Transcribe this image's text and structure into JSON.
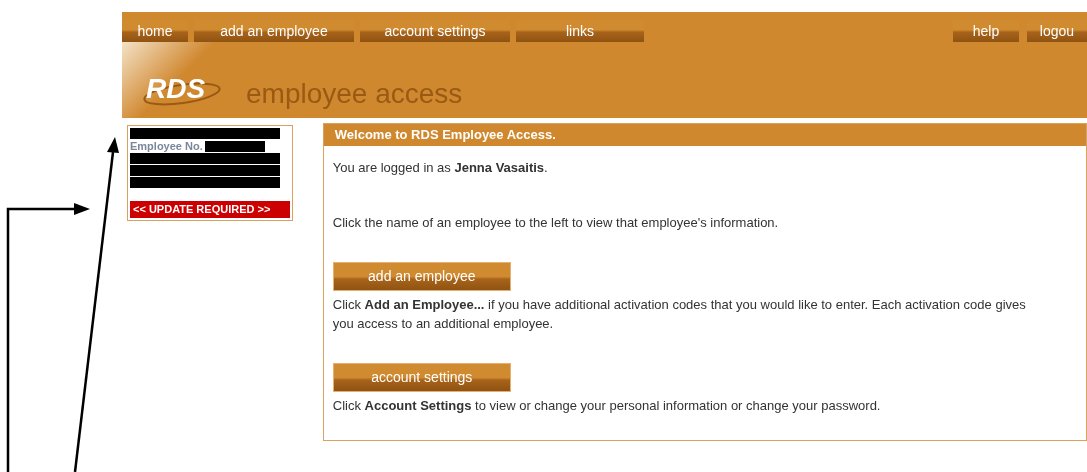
{
  "nav": {
    "left": [
      {
        "label": "home"
      },
      {
        "label": "add an employee"
      },
      {
        "label": "account settings"
      },
      {
        "label": "links"
      }
    ],
    "right": [
      {
        "label": "help"
      },
      {
        "label": "logou"
      }
    ]
  },
  "header": {
    "logo": "RDS",
    "title": "employee access"
  },
  "employee_card": {
    "number_label": "Employee No.",
    "update_button": "<< UPDATE REQUIRED >>"
  },
  "welcome": {
    "title": "Welcome to RDS Employee Access.",
    "logged_in": "You are logged in as **Jenna Vasaitis**.",
    "instruction": "Click the name of an employee to the left to view that employee's information.",
    "sections": [
      {
        "button": "add an employee",
        "text": "Click **Add an Employee...** if you have additional activation codes that you would like to enter. Each activation code gives you access to an additional employee."
      },
      {
        "button": "account settings",
        "text": "Click **Account Settings** to view or change your personal information or change your password."
      }
    ]
  }
}
